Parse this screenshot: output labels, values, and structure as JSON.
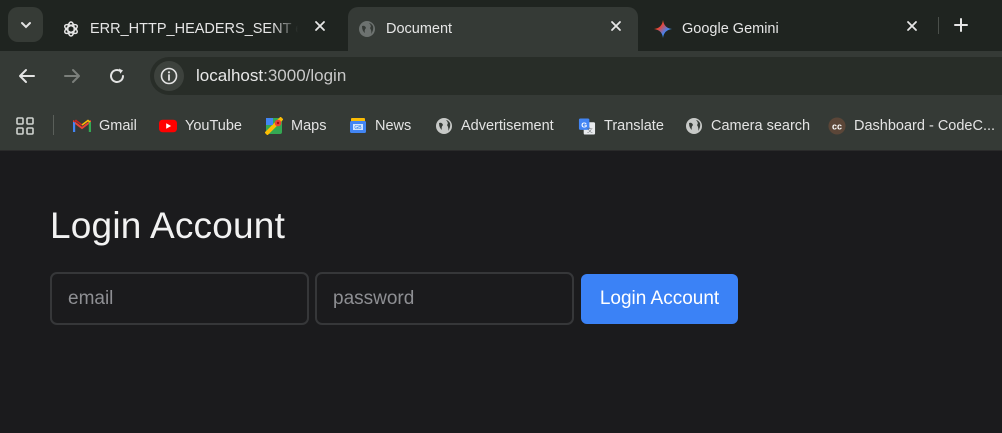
{
  "browser": {
    "tabs": [
      {
        "title": "ERR_HTTP_HEADERS_SENT expl",
        "icon": "chatgpt-icon",
        "active": false
      },
      {
        "title": "Document",
        "icon": "globe-icon",
        "active": true
      },
      {
        "title": "Google Gemini",
        "icon": "gemini-icon",
        "active": false
      }
    ],
    "url": {
      "host": "localhost",
      "path": ":3000/login"
    },
    "bookmarks": [
      {
        "label": "Gmail",
        "icon": "gmail-icon"
      },
      {
        "label": "YouTube",
        "icon": "youtube-icon"
      },
      {
        "label": "Maps",
        "icon": "maps-icon"
      },
      {
        "label": "News",
        "icon": "news-icon"
      },
      {
        "label": "Advertisement",
        "icon": "globe-icon"
      },
      {
        "label": "Translate",
        "icon": "translate-icon"
      },
      {
        "label": "Camera search",
        "icon": "globe-icon"
      },
      {
        "label": "Dashboard - CodeC...",
        "icon": "codechef-icon"
      }
    ],
    "colors": {
      "tabstrip": "#1f2420",
      "toolbar": "#353a36",
      "page": "#1b1b1d"
    }
  },
  "page": {
    "heading": "Login Account",
    "email_placeholder": "email",
    "password_placeholder": "password",
    "submit_label": "Login Account",
    "colors": {
      "accent": "#3b82f6"
    }
  }
}
